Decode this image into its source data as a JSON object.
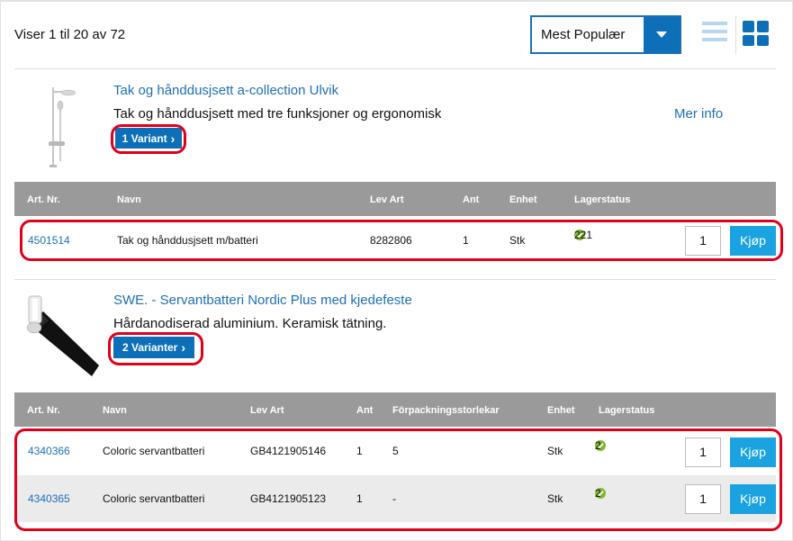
{
  "results": {
    "text": "Viser 1 til 20 av 72"
  },
  "sort": {
    "selected": "Mest Populær"
  },
  "products": [
    {
      "title": "Tak og hånddusjsett a-collection Ulvik",
      "description": "Tak og hånddusjsett med tre funksjoner og ergonomisk",
      "variant_label": "1 Variant",
      "more_info": "Mer info",
      "columns": [
        "Art. Nr.",
        "Navn",
        "Lev Art",
        "Ant",
        "Enhet",
        "Lagerstatus"
      ],
      "rows": [
        {
          "art": "4501514",
          "name": "Tak og hånddusjsett m/batteri",
          "lev": "8282806",
          "ant": "1",
          "enhet": "Stk",
          "stock": "221",
          "qty": "1",
          "buy": "Kjøp"
        }
      ]
    },
    {
      "title": "SWE. - Servantbatteri Nordic Plus med kjedefeste",
      "description": "Hårdanodiserad aluminium. Keramisk tätning.",
      "variant_label": "2 Varianter",
      "columns": [
        "Art. Nr.",
        "Navn",
        "Lev Art",
        "Ant",
        "Förpackningsstorlekar",
        "Enhet",
        "Lagerstatus"
      ],
      "rows": [
        {
          "art": "4340366",
          "name": "Coloric servantbatteri",
          "lev": "GB4121905146",
          "ant": "1",
          "pack": "5",
          "enhet": "Stk",
          "stock": "2",
          "qty": "1",
          "buy": "Kjøp"
        },
        {
          "art": "4340365",
          "name": "Coloric servantbatteri",
          "lev": "GB4121905123",
          "ant": "1",
          "pack": "-",
          "enhet": "Stk",
          "stock": "2",
          "qty": "1",
          "buy": "Kjøp"
        }
      ]
    }
  ],
  "colors": {
    "accent": "#0d6fb8",
    "link": "#1d6fb8",
    "buy": "#1aa3e0",
    "highlight": "#e0001a",
    "header_bg": "#9a9a9a",
    "in_stock": "#7cb82f"
  },
  "icons": {
    "sort_toggle": "chevron-down-icon",
    "list_view": "list-view-icon",
    "grid_view": "grid-view-icon",
    "stock_ok": "check-circle-icon",
    "variant": "chevron-right-icon"
  }
}
